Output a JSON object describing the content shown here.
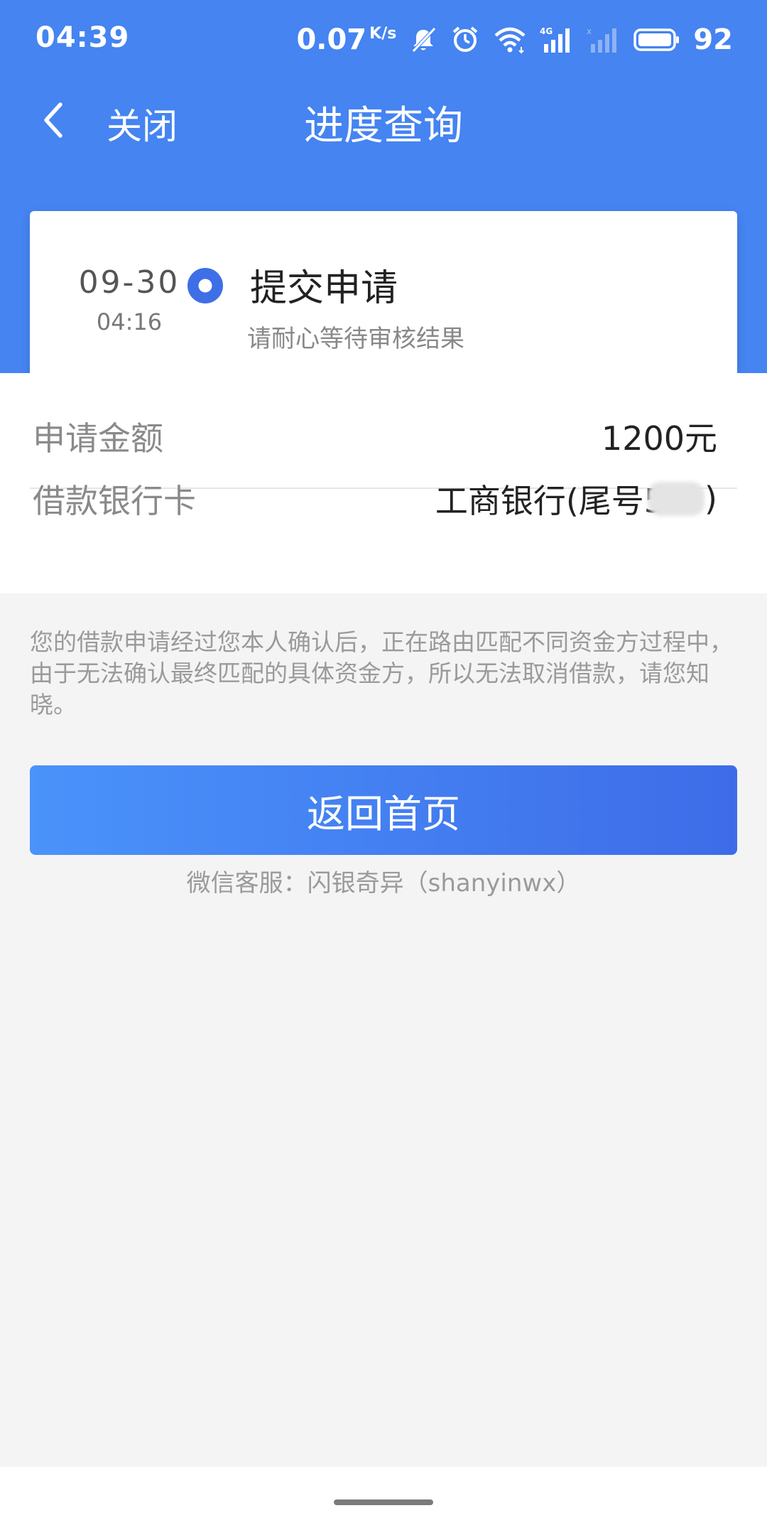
{
  "status_bar": {
    "time": "04:39",
    "network_speed": "0.07",
    "network_speed_unit": "K/s",
    "battery_level": "92",
    "icons": [
      "bell-muted-icon",
      "alarm-icon",
      "wifi-icon",
      "signal-4g-icon",
      "signal-weak-icon",
      "battery-icon"
    ]
  },
  "nav": {
    "back_icon": "chevron-left-icon",
    "close_label": "关闭",
    "title": "进度查询"
  },
  "progress": {
    "date": "09-30",
    "time": "04:16",
    "step_title": "提交申请",
    "step_subtitle": "请耐心等待审核结果"
  },
  "info": {
    "amount_label": "申请金额",
    "amount_value": "1200元",
    "card_label": "借款银行卡",
    "card_value_prefix": "工商银行(尾号5",
    "card_value_suffix": ")"
  },
  "notice": "您的借款申请经过您本人确认后，正在路由匹配不同资金方过程中，由于无法确认最终匹配的具体资金方，所以无法取消借款，请您知晓。",
  "actions": {
    "home_button": "返回首页"
  },
  "footer": {
    "service_text": "微信客服：闪银奇异（shanyinwx）"
  },
  "colors": {
    "header_blue": "#4584f1",
    "button_gradient_start": "#4a93fb",
    "button_gradient_end": "#3e6ce8",
    "step_dot": "#3f6fe6"
  }
}
